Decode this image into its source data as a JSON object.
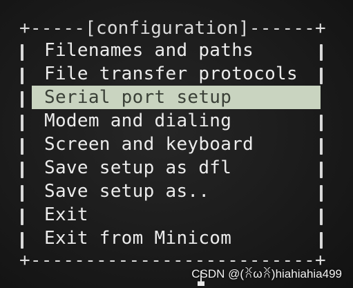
{
  "window": {
    "title": "[configuration]",
    "top_border": "+-----[configuration]------+",
    "bottom_border": "+--------------------------+"
  },
  "menu": {
    "items": [
      {
        "label": "Filenames and paths",
        "selected": false
      },
      {
        "label": "File transfer protocols",
        "selected": false
      },
      {
        "label": "Serial port setup",
        "selected": true
      },
      {
        "label": "Modem and dialing",
        "selected": false
      },
      {
        "label": "Screen and keyboard",
        "selected": false
      },
      {
        "label": "Save setup as dfl",
        "selected": false
      },
      {
        "label": "Save setup as..",
        "selected": false
      },
      {
        "label": "Exit",
        "selected": false
      },
      {
        "label": "Exit from Minicom",
        "selected": false
      }
    ]
  },
  "watermark": {
    "text": "CSDN @(ꐦωꐦ)hiahiahia499"
  },
  "colors": {
    "background": "#1c1c1c",
    "text": "#ececec",
    "highlight_bg": "#c9d4c0",
    "highlight_text": "#3a4037"
  }
}
